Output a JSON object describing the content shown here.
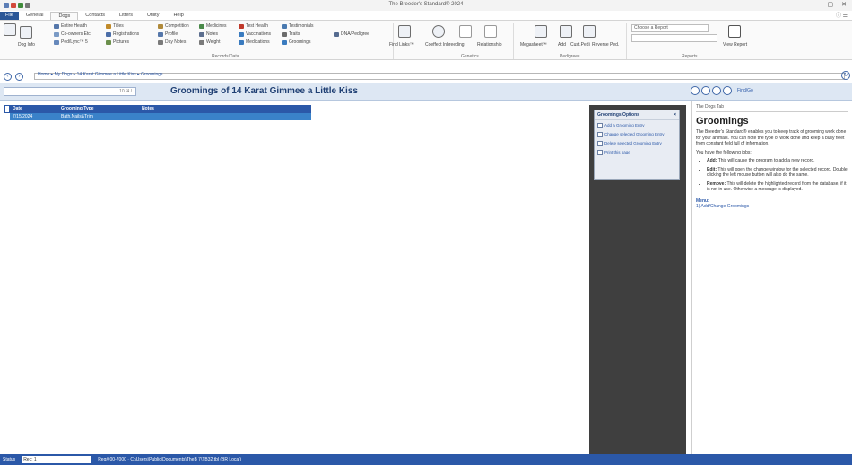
{
  "window": {
    "title": "The Breeder's Standard® 2024",
    "controls": [
      "–",
      "▢",
      "✕"
    ]
  },
  "ribbon_tabs": [
    "File",
    "General",
    "Dogs",
    "Contacts",
    "Litters",
    "Utility",
    "Help"
  ],
  "ribbon": {
    "dogs_buttons": [
      "Dog Info"
    ],
    "record_items": [
      "Entire Health",
      "Co-owners Etc.",
      "Ped/Lync™ 5",
      "Titles",
      "Registrations",
      "Pictures",
      "Competition",
      "Profile",
      "Day Notes",
      "Medicines",
      "Notes",
      "Weight",
      "Test Health",
      "Vaccinations",
      "Medications",
      "Testimonials",
      "Traits",
      "Groomings",
      "DNA/Pedigree"
    ],
    "group_labels": {
      "records": "Records/Data",
      "genetics": "Genetics",
      "pedigrees": "Pedigrees",
      "reports": "Reports"
    },
    "genetics_buttons": [
      "Find Links™",
      "Coeffect Inbreeding",
      "Relationship"
    ],
    "pedigree_buttons": [
      "Megasheet™",
      "Add",
      "Cust.Pedi",
      "Reverse Ped."
    ],
    "search_placeholder": "Choose a Report",
    "view_report": "View Report"
  },
  "breadcrumb": "Home ▸ My Dogs ▸ 14 Karat Gimmee a Little Kiss ▸ Groomings",
  "heading": {
    "filter_value": "10 /4 /",
    "page_title": "Groomings of 14 Karat Gimmee a Little Kiss",
    "find_label": "Find/Go"
  },
  "table": {
    "columns": [
      "Date",
      "Grooming Type",
      "Notes"
    ],
    "rows": [
      [
        "7/15/2024",
        "Bath,Nails&Trim",
        ""
      ]
    ]
  },
  "options_panel": {
    "title": "Groomings Options",
    "close": "×",
    "items": [
      "Add a Grooming Entry",
      "Change selected Grooming Entry",
      "Delete selected Grooming Entry",
      "Print this page"
    ]
  },
  "help": {
    "crumb": "The Dogs Tab",
    "title": "Groomings",
    "intro": "The Breeder's Standard® enables you to keep track of grooming work done for your animals. You can note the type of work done and keep a busy fleet from constant field full of information.",
    "lead": "You have the following jobs:",
    "items": [
      {
        "term": "Add:",
        "text": "This will cause the program to add a new record."
      },
      {
        "term": "Edit:",
        "text": "This will open the change window for the selected record. Double clicking the left mouse button will also do the same."
      },
      {
        "term": "Remove:",
        "text": "This will delete the highlighted record from the database, if it is not in use. Otherwise a message is displayed."
      }
    ],
    "menu_label": "Menu:",
    "menu_link": "1) Add/Change Groomings"
  },
  "status": {
    "left_label": "Status",
    "left_value": "Rec: 1",
    "path": "Reg# 00-7000 · C:\\Users\\Public\\Documents\\TheB 7\\TB32.tbl (BR Local)"
  }
}
